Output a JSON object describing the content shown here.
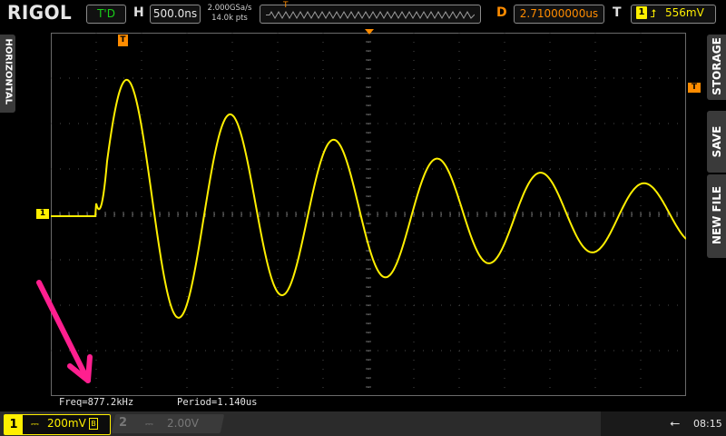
{
  "brand": "RIGOL",
  "run_state": "T'D",
  "horizontal": {
    "letter": "H",
    "timebase": "500.0ns",
    "sample_rate": "2.000GSa/s",
    "memory_depth": "14.0k pts"
  },
  "delay": {
    "letter": "D",
    "value": "2.71000000us"
  },
  "trigger": {
    "letter": "T",
    "source": "1",
    "edge_icon": "rising-edge-icon",
    "level": "556mV"
  },
  "side_tabs": {
    "left": "HORIZONTAL",
    "right": [
      "STORAGE",
      "SAVE",
      "NEW FILE"
    ]
  },
  "markers": {
    "channel1": "1",
    "trigger_position": "T",
    "trigger_level": "T"
  },
  "measurements": {
    "freq": "Freq=877.2kHz",
    "period": "Period=1.140us"
  },
  "channels": [
    {
      "number": "1",
      "coupling": "⎓",
      "scale": "200mV",
      "bw_limit": "B",
      "active": true
    },
    {
      "number": "2",
      "coupling": "⎓",
      "scale": "2.00V",
      "active": false
    }
  ],
  "status": {
    "usb_icon": "usb-icon",
    "time": "08:15"
  },
  "colors": {
    "ch1": "#ffef00",
    "trigger": "#ff8c00",
    "running": "#19d019",
    "annotation": "#ff1f8f"
  },
  "waveform": {
    "frequency_khz": 877.2,
    "trigger_level_mv": 556,
    "volts_per_div_mv": 200,
    "time_per_div_ns": 500
  }
}
